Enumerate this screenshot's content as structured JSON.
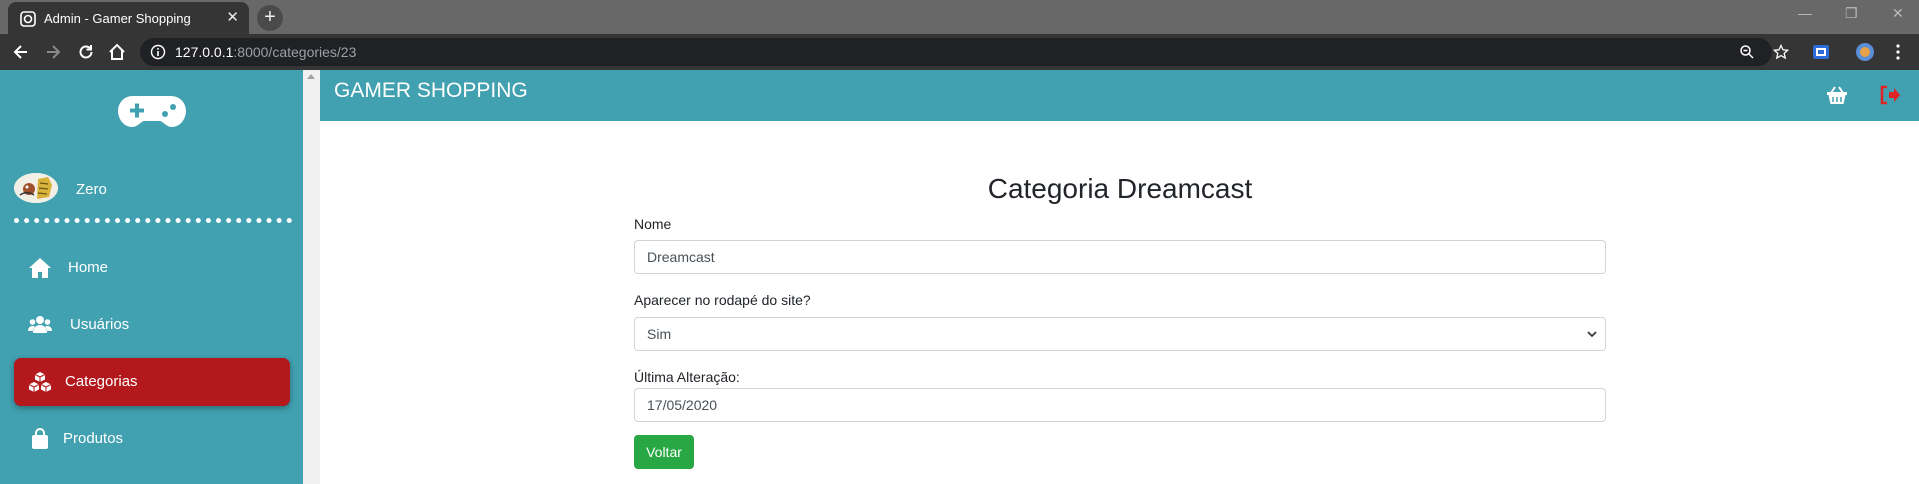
{
  "browser": {
    "tab_title": "Admin - Gamer Shopping",
    "url_host": "127.0.0.1",
    "url_rest": ":8000/categories/23"
  },
  "sidebar": {
    "username": "Zero",
    "items": [
      {
        "label": "Home",
        "icon": "home-icon"
      },
      {
        "label": "Usuários",
        "icon": "users-icon"
      },
      {
        "label": "Categorias",
        "icon": "categories-icon",
        "active": true
      },
      {
        "label": "Produtos",
        "icon": "shopping-bag-icon"
      }
    ]
  },
  "header": {
    "brand": "GAMER SHOPPING"
  },
  "form": {
    "title": "Categoria Dreamcast",
    "name_label": "Nome",
    "name_value": "Dreamcast",
    "footer_label": "Aparecer no rodapé do site?",
    "footer_value": "Sim",
    "updated_label": "Última Alteração:",
    "updated_value": "17/05/2020",
    "back_label": "Voltar"
  },
  "colors": {
    "accent": "#41a1b0",
    "active_nav": "#b3181d",
    "button_green": "#28a745",
    "logout_red": "#e02424"
  }
}
